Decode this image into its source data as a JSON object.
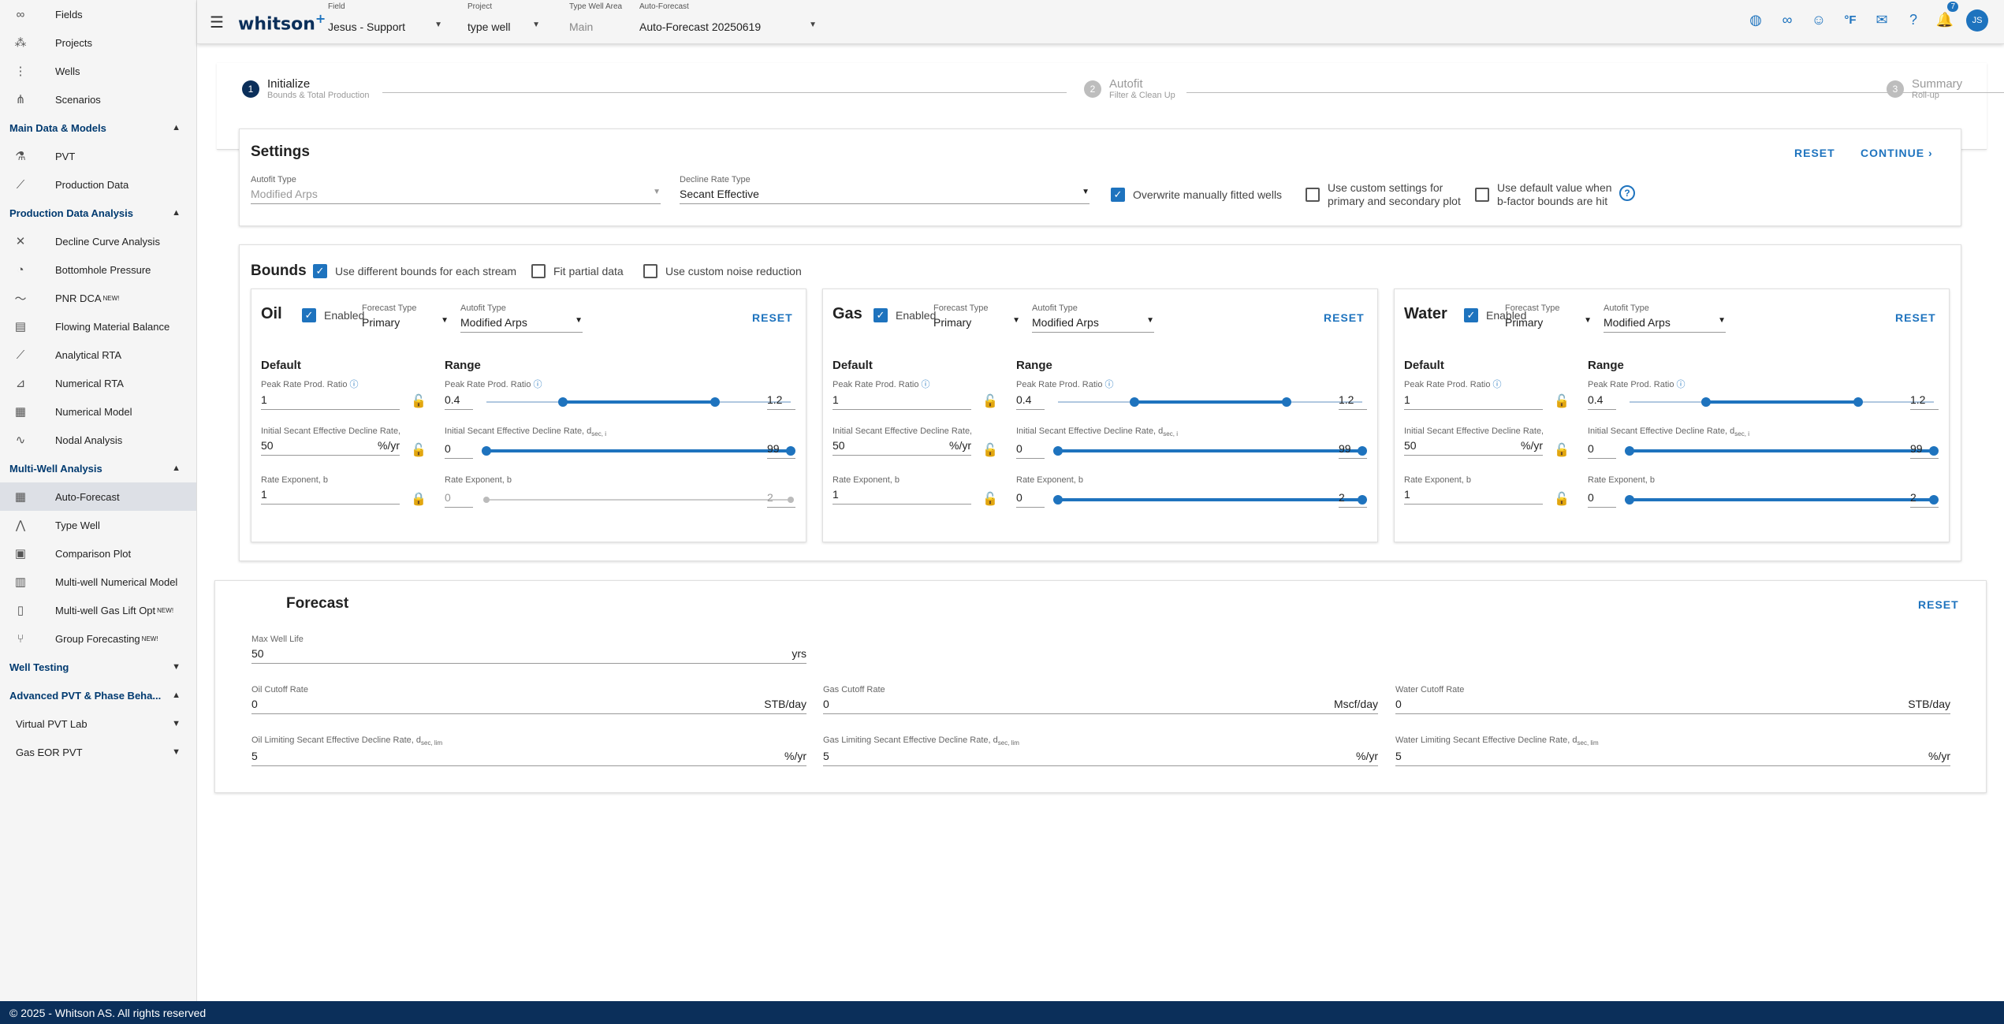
{
  "sidebar": {
    "top_items": [
      {
        "label": "Fields",
        "icon": "fields-icon"
      },
      {
        "label": "Projects",
        "icon": "projects-icon"
      },
      {
        "label": "Wells",
        "icon": "wells-icon"
      },
      {
        "label": "Scenarios",
        "icon": "scenarios-icon"
      }
    ],
    "sections": [
      {
        "title": "Main Data & Models",
        "items": [
          {
            "label": "PVT",
            "icon": "flask-icon"
          },
          {
            "label": "Production Data",
            "icon": "line-chart-icon"
          }
        ]
      },
      {
        "title": "Production Data Analysis",
        "items": [
          {
            "label": "Decline Curve Analysis",
            "icon": "decline-icon"
          },
          {
            "label": "Bottomhole Pressure",
            "icon": "gauge-icon"
          },
          {
            "label": "PNR DCA",
            "sup": "NEW!",
            "icon": "trend-icon"
          },
          {
            "label": "Flowing Material Balance",
            "icon": "chart-icon"
          },
          {
            "label": "Analytical RTA",
            "icon": "rta-icon"
          },
          {
            "label": "Numerical RTA",
            "icon": "numerical-rta-icon"
          },
          {
            "label": "Numerical Model",
            "icon": "grid-model-icon"
          },
          {
            "label": "Nodal Analysis",
            "icon": "nodal-icon"
          }
        ]
      },
      {
        "title": "Multi-Well Analysis",
        "items": [
          {
            "label": "Auto-Forecast",
            "icon": "grid-icon",
            "active": true
          },
          {
            "label": "Type Well",
            "icon": "type-well-icon"
          },
          {
            "label": "Comparison Plot",
            "icon": "comparison-icon"
          },
          {
            "label": "Multi-well Numerical Model",
            "icon": "multiwell-icon"
          },
          {
            "label": "Multi-well Gas Lift Opt",
            "sup": "NEW!",
            "icon": "gaslift-icon"
          },
          {
            "label": "Group Forecasting",
            "sup": "NEW!",
            "icon": "group-icon"
          }
        ]
      }
    ],
    "collapsed": [
      "Well Testing"
    ],
    "adv_title": "Advanced PVT & Phase Beha...",
    "adv_sub": [
      "Virtual PVT Lab",
      "Gas EOR PVT"
    ]
  },
  "topbar": {
    "logo": "whitson",
    "field_label": "Field",
    "field_value": "Jesus - Support",
    "project_label": "Project",
    "project_value": "type well",
    "twa_label": "Type Well Area",
    "twa_value": "Main",
    "af_label": "Auto-Forecast",
    "af_value": "Auto-Forecast 20250619",
    "unit": "°F",
    "notifications": "7",
    "avatar": "JS"
  },
  "stepper": [
    {
      "num": "1",
      "title": "Initialize",
      "sub": "Bounds & Total Production"
    },
    {
      "num": "2",
      "title": "Autofit",
      "sub": "Filter & Clean Up"
    },
    {
      "num": "3",
      "title": "Summary",
      "sub": "Roll-up"
    }
  ],
  "settings": {
    "title": "Settings",
    "reset": "RESET",
    "continue": "CONTINUE",
    "autofit_label": "Autofit Type",
    "autofit_value": "Modified Arps",
    "decline_label": "Decline Rate Type",
    "decline_value": "Secant Effective",
    "overwrite": "Overwrite manually fitted wells",
    "custom1": "Use custom settings for",
    "custom2": "primary and secondary plot",
    "default1": "Use default value when",
    "default2": "b-factor bounds are hit"
  },
  "bounds": {
    "title": "Bounds",
    "diff": "Use different bounds for each stream",
    "partial": "Fit partial data",
    "noise": "Use custom noise reduction",
    "enabled": "Enabled",
    "reset": "RESET",
    "forecast_type_label": "Forecast Type",
    "autofit_type_label": "Autofit Type",
    "default_h": "Default",
    "range_h": "Range",
    "prr_label": "Peak Rate Prod. Ratio",
    "isd_label": "Initial Secant Effective Decline Rate, d",
    "isd_sub": "sec, i",
    "b_label": "Rate Exponent, b",
    "pct_unit": "%/yr",
    "streams": [
      {
        "name": "Oil",
        "forecast": "Primary",
        "autofit": "Modified Arps",
        "prr_default": "1",
        "isd_default": "50",
        "b_default": "1",
        "prr_min": "0.4",
        "prr_max": "1.2",
        "isd_min": "0",
        "isd_max": "99",
        "b_min": "0",
        "b_max": "2",
        "prr_range": [
          0.4,
          1.2
        ],
        "isd_range": [
          0,
          99
        ],
        "b_range": [
          0,
          2
        ],
        "b_disabled": true
      },
      {
        "name": "Gas",
        "forecast": "Primary",
        "autofit": "Modified Arps",
        "prr_default": "1",
        "isd_default": "50",
        "b_default": "1",
        "prr_min": "0.4",
        "prr_max": "1.2",
        "isd_min": "0",
        "isd_max": "99",
        "b_min": "0",
        "b_max": "2",
        "prr_range": [
          0.4,
          1.2
        ],
        "isd_range": [
          0,
          99
        ],
        "b_range": [
          0,
          2
        ],
        "b_disabled": false
      },
      {
        "name": "Water",
        "forecast": "Primary",
        "autofit": "Modified Arps",
        "prr_default": "1",
        "isd_default": "50",
        "b_default": "1",
        "prr_min": "0.4",
        "prr_max": "1.2",
        "isd_min": "0",
        "isd_max": "99",
        "b_min": "0",
        "b_max": "2",
        "prr_range": [
          0.4,
          1.2
        ],
        "isd_range": [
          0,
          99
        ],
        "b_range": [
          0,
          2
        ],
        "b_disabled": false
      }
    ]
  },
  "forecast": {
    "title": "Forecast",
    "reset": "RESET",
    "mwl_label": "Max Well Life",
    "mwl_value": "50",
    "mwl_unit": "yrs",
    "oil_cut_label": "Oil Cutoff Rate",
    "oil_cut_value": "0",
    "oil_cut_unit": "STB/day",
    "gas_cut_label": "Gas Cutoff Rate",
    "gas_cut_value": "0",
    "gas_cut_unit": "Mscf/day",
    "water_cut_label": "Water Cutoff Rate",
    "water_cut_value": "0",
    "water_cut_unit": "STB/day",
    "oil_lim_label": "Oil Limiting Secant Effective Decline Rate, d",
    "oil_lim_value": "5",
    "gas_lim_label": "Gas Limiting Secant Effective Decline Rate, d",
    "gas_lim_value": "5",
    "water_lim_label": "Water Limiting Secant Effective Decline Rate, d",
    "water_lim_value": "5",
    "lim_sub": "sec, lim",
    "lim_unit": "%/yr"
  },
  "footer": "© 2025 - Whitson AS. All rights reserved"
}
